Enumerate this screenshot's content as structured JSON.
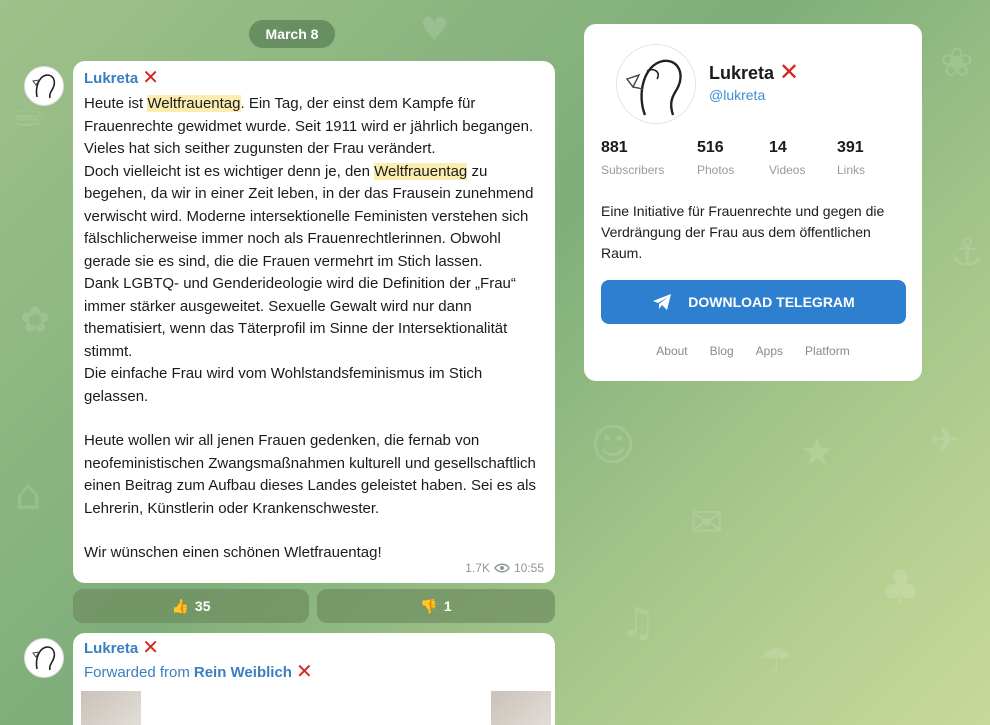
{
  "date_label": "March 8",
  "message1": {
    "author": "Lukreta",
    "paragraphs": [
      {
        "pre": "Heute ist ",
        "hl": "Weltfrauentag",
        "post": ". Ein Tag, der einst dem Kampfe für Frauenrechte gewidmet wurde. Seit 1911 wird er jährlich begangen. Vieles hat sich seither zugunsten der Frau verändert."
      },
      {
        "pre": "Doch vielleicht ist es wichtiger denn je, den ",
        "hl": "Weltfrauentag",
        "post": " zu begehen, da wir in einer Zeit leben, in der das Frausein zunehmend verwischt wird. Moderne intersektionelle Feministen verstehen sich fälschlicherweise immer noch als Frauenrechtlerinnen. Obwohl gerade sie es sind, die die Frauen vermehrt im Stich lassen."
      },
      {
        "text": "Dank LGBTQ- und Genderideologie wird die Definition der „Frau“ immer stärker ausgeweitet. Sexuelle Gewalt wird nur dann thematisiert, wenn das Täterprofil im Sinne der Intersektionalität stimmt."
      },
      {
        "text": "Die einfache Frau wird vom Wohlstandsfeminismus im Stich gelassen."
      },
      {
        "text": "Heute wollen wir all jenen Frauen gedenken, die fernab von neofeministischen Zwangsmaßnahmen kulturell und gesellschaftlich einen Beitrag zum Aufbau dieses Landes geleistet haben. Sei es als Lehrerin, Künstlerin oder Krankenschwester."
      },
      {
        "text": "Wir wünschen einen schönen Wletfrauentag!"
      }
    ],
    "views": "1.7K",
    "time": "10:55"
  },
  "reactions": [
    {
      "emoji": "👍",
      "count": "35"
    },
    {
      "emoji": "👎",
      "count": "1"
    }
  ],
  "message2": {
    "author": "Lukreta",
    "forwarded_prefix": "Forwarded from",
    "forwarded_name": "Rein Weiblich"
  },
  "channel": {
    "name": "Lukreta",
    "handle": "@lukreta",
    "stats": [
      {
        "value": "881",
        "label": "Subscribers"
      },
      {
        "value": "516",
        "label": "Photos"
      },
      {
        "value": "14",
        "label": "Videos"
      },
      {
        "value": "391",
        "label": "Links"
      }
    ],
    "description": "Eine Initiative für Frauenrechte und gegen die Verdrängung der Frau aus dem öffentlichen Raum.",
    "download_label": "DOWNLOAD TELEGRAM",
    "links": [
      "About",
      "Blog",
      "Apps",
      "Platform"
    ]
  },
  "colors": {
    "accent": "#2f7fd0",
    "link": "#3a7fc1",
    "verified_mark": "#d7261e",
    "highlight": "#fbedb0"
  }
}
